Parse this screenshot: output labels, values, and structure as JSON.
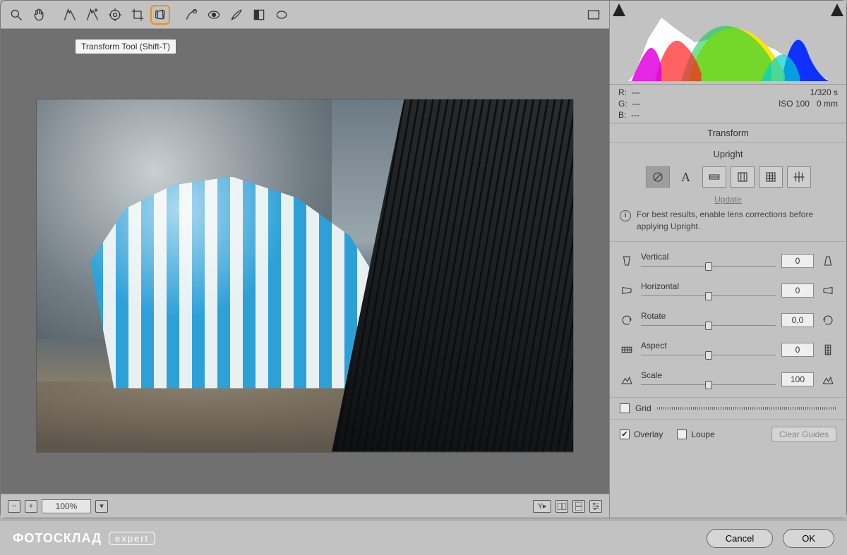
{
  "tooltip": "Transform Tool (Shift-T)",
  "status": {
    "zoom": "100%"
  },
  "readout": {
    "R": "---",
    "G": "---",
    "B": "---",
    "shutter": "1/320 s",
    "iso": "ISO 100",
    "focal": "0 mm"
  },
  "panel_title": "Transform",
  "upright": {
    "title": "Upright",
    "update": "Update",
    "info": "For best results, enable lens corrections before applying Upright."
  },
  "sliders": {
    "vertical": {
      "label": "Vertical",
      "value": "0",
      "pos": 50
    },
    "horizontal": {
      "label": "Horizontal",
      "value": "0",
      "pos": 50
    },
    "rotate": {
      "label": "Rotate",
      "value": "0,0",
      "pos": 50
    },
    "aspect": {
      "label": "Aspect",
      "value": "0",
      "pos": 50
    },
    "scale": {
      "label": "Scale",
      "value": "100",
      "pos": 50
    }
  },
  "grid": {
    "label": "Grid",
    "checked": false
  },
  "overlay": {
    "label": "Overlay",
    "checked": true
  },
  "loupe": {
    "label": "Loupe",
    "checked": false
  },
  "clear_guides": "Clear Guides",
  "footer": {
    "brand": "ФОТОСКЛАД",
    "badge": "expert",
    "cancel": "Cancel",
    "ok": "OK"
  }
}
